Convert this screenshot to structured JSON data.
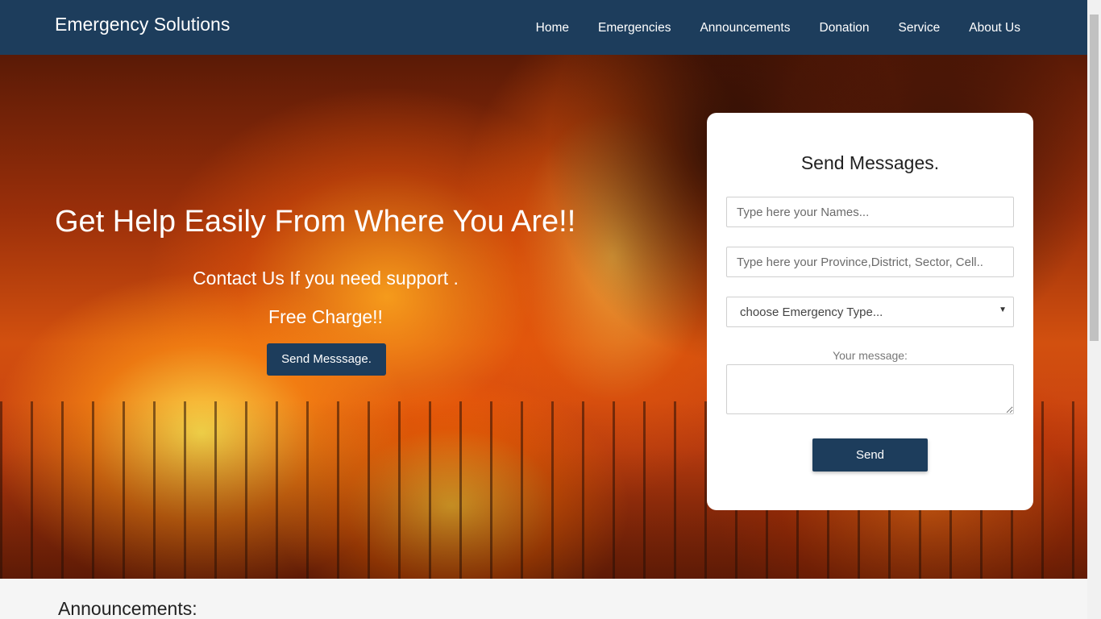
{
  "navbar": {
    "brand": "Emergency Solutions",
    "links": [
      {
        "label": "Home"
      },
      {
        "label": "Emergencies"
      },
      {
        "label": "Announcements"
      },
      {
        "label": "Donation"
      },
      {
        "label": "Service"
      },
      {
        "label": "About Us"
      }
    ]
  },
  "hero": {
    "title": "Get Help Easily From Where You Are!!",
    "subtitle": "Contact Us If you need support .",
    "subtitle2": "Free Charge!!",
    "button": "Send Messsage."
  },
  "form": {
    "title": "Send Messages.",
    "name_placeholder": "Type here your Names...",
    "location_placeholder": "Type here your Province,District, Sector, Cell..",
    "emergency_type_selected": "choose Emergency Type...",
    "message_label": "Your message:",
    "send_label": "Send"
  },
  "announcements": {
    "title": "Announcements:"
  },
  "colors": {
    "navbar": "#1d3d5c",
    "button": "#1d3d5c"
  }
}
